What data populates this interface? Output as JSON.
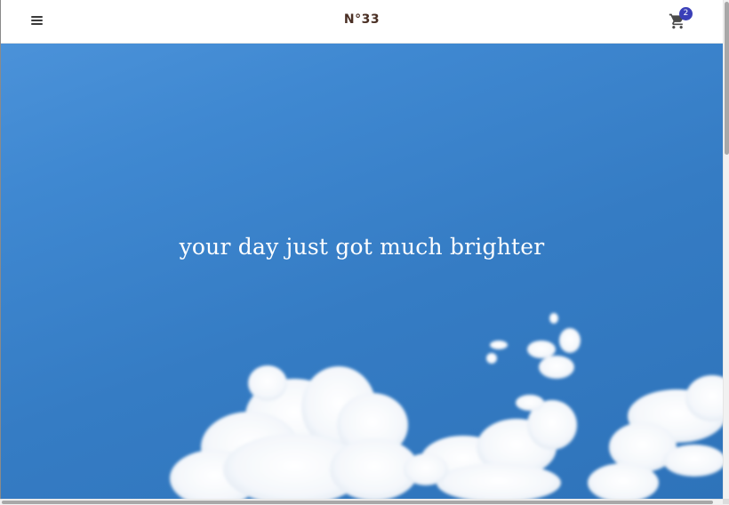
{
  "header": {
    "logo_text": "N°33",
    "cart_count": "2"
  },
  "hero": {
    "tagline": "your day just got much brighter"
  },
  "icons": {
    "menu": "menu-icon",
    "cart": "cart-icon"
  },
  "colors": {
    "sky": "#357cc4",
    "badge": "#3a3fb8",
    "logo": "#4a2f24"
  }
}
